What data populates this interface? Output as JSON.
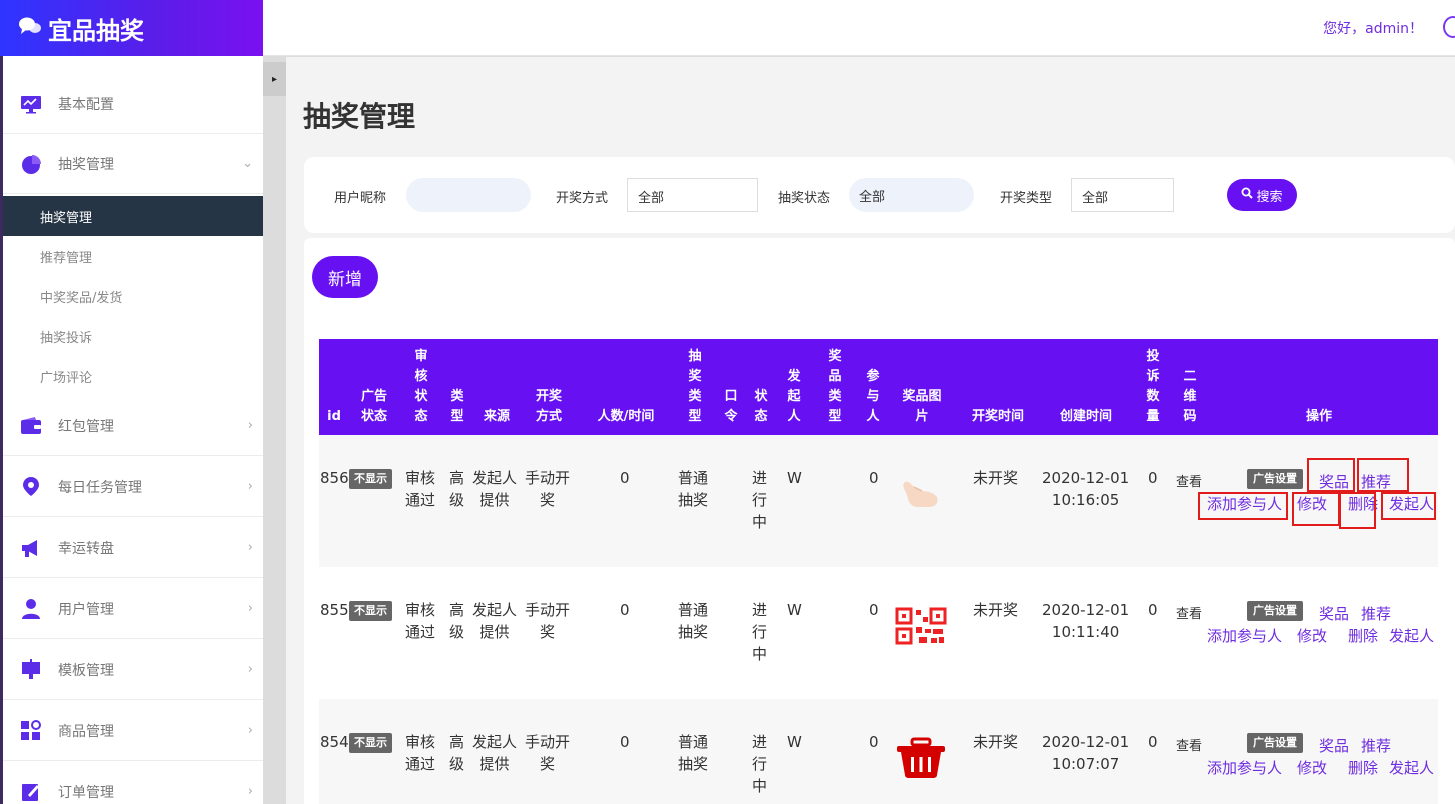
{
  "app": {
    "logo_icon": "chat-bubbles-icon",
    "logo_text": "宜品抽奖",
    "greeting": "您好，admin！"
  },
  "sidebar": {
    "items": [
      {
        "label": "基本配置",
        "icon": "monitor-chart-icon"
      },
      {
        "label": "抽奖管理",
        "icon": "pie-chart-icon"
      },
      {
        "label": "红包管理",
        "icon": "wallet-icon"
      },
      {
        "label": "每日任务管理",
        "icon": "location-pin-icon"
      },
      {
        "label": "幸运转盘",
        "icon": "megaphone-icon"
      },
      {
        "label": "用户管理",
        "icon": "user-icon"
      },
      {
        "label": "模板管理",
        "icon": "board-icon"
      },
      {
        "label": "商品管理",
        "icon": "grid-shapes-icon"
      },
      {
        "label": "订单管理",
        "icon": "edit-icon"
      }
    ],
    "subitems": [
      "抽奖管理",
      "推荐管理",
      "中奖奖品/发货",
      "抽奖投诉",
      "广场评论"
    ],
    "expand_chevron": "⌄",
    "chevron": "›"
  },
  "page": {
    "title": "抽奖管理",
    "collapse_icon": "▸"
  },
  "filters": {
    "nickname_label": "用户昵称",
    "nickname_value": "",
    "method_label": "开奖方式",
    "method_value": "全部",
    "status_label": "抽奖状态",
    "status_value": "全部",
    "type_label": "开奖类型",
    "type_value": "全部",
    "search_icon": "🔍",
    "search_button": "搜索"
  },
  "add_button": "新增",
  "table": {
    "headers": {
      "id": "id",
      "ad_status": "广告\n状态",
      "review_status": "审\n核\n状\n态",
      "type": "类\n型",
      "source": "来源",
      "open_method": "开奖\n方式",
      "people_time": "人数/时间",
      "lottery_type": "抽\n奖\n类\n型",
      "password": "口\n令",
      "status": "状\n态",
      "initiator": "发\n起\n人",
      "prize_type": "奖\n品\n类\n型",
      "participants": "参\n与\n人",
      "prize_image": "奖品图\n片",
      "open_time": "开奖时间",
      "created_time": "创建时间",
      "complaints": "投\n诉\n数\n量",
      "qrcode": "二\n维\n码",
      "actions": "操作"
    },
    "rows": [
      {
        "id": "856",
        "ad_status": "不显示",
        "review": "审核\n通过",
        "type": "高\n级",
        "source": "发起人\n提供",
        "method": "手动开\n奖",
        "people": "0",
        "lottery_type": "普通\n抽奖",
        "status": "进\n行\n中",
        "initiator": "W",
        "participants": "0",
        "image": "pointing-hand-icon",
        "open_time": "未开奖",
        "created": "2020-12-01\n10:16:05",
        "complaints": "0",
        "qrcode": "查看",
        "ad_settings": "广告设置",
        "prize": "奖品",
        "recommend": "推荐",
        "add_participant": "添加参与人",
        "edit": "修改",
        "delete": "删除",
        "initiator_link": "发起人"
      },
      {
        "id": "855",
        "ad_status": "不显示",
        "review": "审核\n通过",
        "type": "高\n级",
        "source": "发起人\n提供",
        "method": "手动开\n奖",
        "people": "0",
        "lottery_type": "普通\n抽奖",
        "status": "进\n行\n中",
        "initiator": "W",
        "participants": "0",
        "image": "qr-code-icon",
        "open_time": "未开奖",
        "created": "2020-12-01\n10:11:40",
        "complaints": "0",
        "qrcode": "查看",
        "ad_settings": "广告设置",
        "prize": "奖品",
        "recommend": "推荐",
        "add_participant": "添加参与人",
        "edit": "修改",
        "delete": "删除",
        "initiator_link": "发起人"
      },
      {
        "id": "854",
        "ad_status": "不显示",
        "review": "审核\n通过",
        "type": "高\n级",
        "source": "发起人\n提供",
        "method": "手动开\n奖",
        "people": "0",
        "lottery_type": "普通\n抽奖",
        "status": "进\n行\n中",
        "initiator": "W",
        "participants": "0",
        "image": "trash-basket-icon",
        "open_time": "未开奖",
        "created": "2020-12-01\n10:07:07",
        "complaints": "0",
        "qrcode": "查看",
        "ad_settings": "广告设置",
        "prize": "奖品",
        "recommend": "推荐",
        "add_participant": "添加参与人",
        "edit": "修改",
        "delete": "删除",
        "initiator_link": "发起人"
      }
    ]
  },
  "colors": {
    "accent": "#6710f2",
    "link": "#6f2de0",
    "sidebar_active": "#263545",
    "highlight_box": "#e21b1b"
  }
}
